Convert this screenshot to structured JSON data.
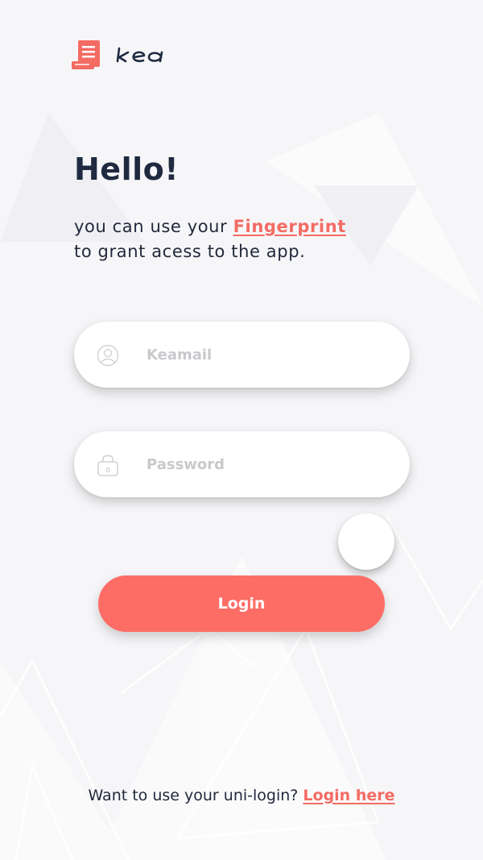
{
  "brand": {
    "logo_text": "kea",
    "icon": "receipt-icon"
  },
  "heading": {
    "title": "Hello!",
    "line1_prefix": "you can use your ",
    "fingerprint_link": "Fingerprint",
    "line2": "to grant acess to the app."
  },
  "form": {
    "email": {
      "placeholder": "Keamail",
      "value": "",
      "icon": "user-icon"
    },
    "password": {
      "placeholder": "Password",
      "value": "",
      "icon": "lock-icon"
    },
    "fingerprint_button_icon": "circle-button",
    "login_label": "Login"
  },
  "footer": {
    "prompt": "Want to use your uni-login? ",
    "link": "Login here"
  },
  "colors": {
    "accent": "#fd6d66",
    "text": "#1f2a40",
    "placeholder": "#c9c9cd",
    "background": "#f6f6f8"
  }
}
